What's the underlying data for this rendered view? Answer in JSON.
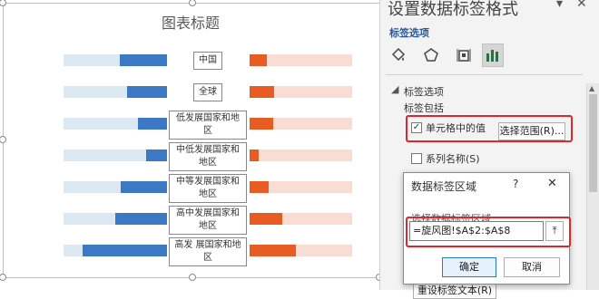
{
  "chart": {
    "title": "图表标题",
    "categories": [
      "中国",
      "全球",
      "低发展国家和地区",
      "中低发展国家和地区",
      "中等发展国家和地区",
      "高中发展国家和地区",
      "高发 展国家和地区"
    ],
    "label_lines": [
      [
        "中国"
      ],
      [
        "全球"
      ],
      [
        "低发展国家和地",
        "区"
      ],
      [
        "中低发展国家和",
        "地区"
      ],
      [
        "中等发展国家和",
        "地区"
      ],
      [
        "高中发展国家和",
        "地区"
      ],
      [
        "高发 展国家和地",
        "区"
      ]
    ],
    "left_fraction": [
      0.46,
      0.39,
      0.28,
      0.2,
      0.45,
      0.5,
      0.82
    ],
    "right_fraction": [
      0.17,
      0.24,
      0.23,
      0.09,
      0.19,
      0.32,
      0.45
    ],
    "colors": {
      "blue": "#3c78c3",
      "blue_track": "#dce9f3",
      "orange": "#e85b22",
      "orange_track": "#f9ddd5"
    }
  },
  "pane": {
    "title": "设置数据标签格式",
    "section": "标签选项",
    "tabs": [
      "paint-bucket-icon",
      "pentagon-icon",
      "size-properties-icon",
      "bar-chart-icon"
    ],
    "group_title": "标签选项",
    "label_contains": "标签包括",
    "value_from_cells": "单元格中的值",
    "value_from_cells_checked": true,
    "select_range_button": "选择范围(R)...",
    "series_name": "系列名称(S)",
    "series_name_checked": false,
    "reset_text": "重设标签文本(R)"
  },
  "dialog": {
    "title": "数据标签区域",
    "help": "?",
    "prompt": "选择数据标签区域",
    "range_value": "=旋风图!$A$2:$A$8",
    "ok": "确定",
    "cancel": "取消"
  }
}
